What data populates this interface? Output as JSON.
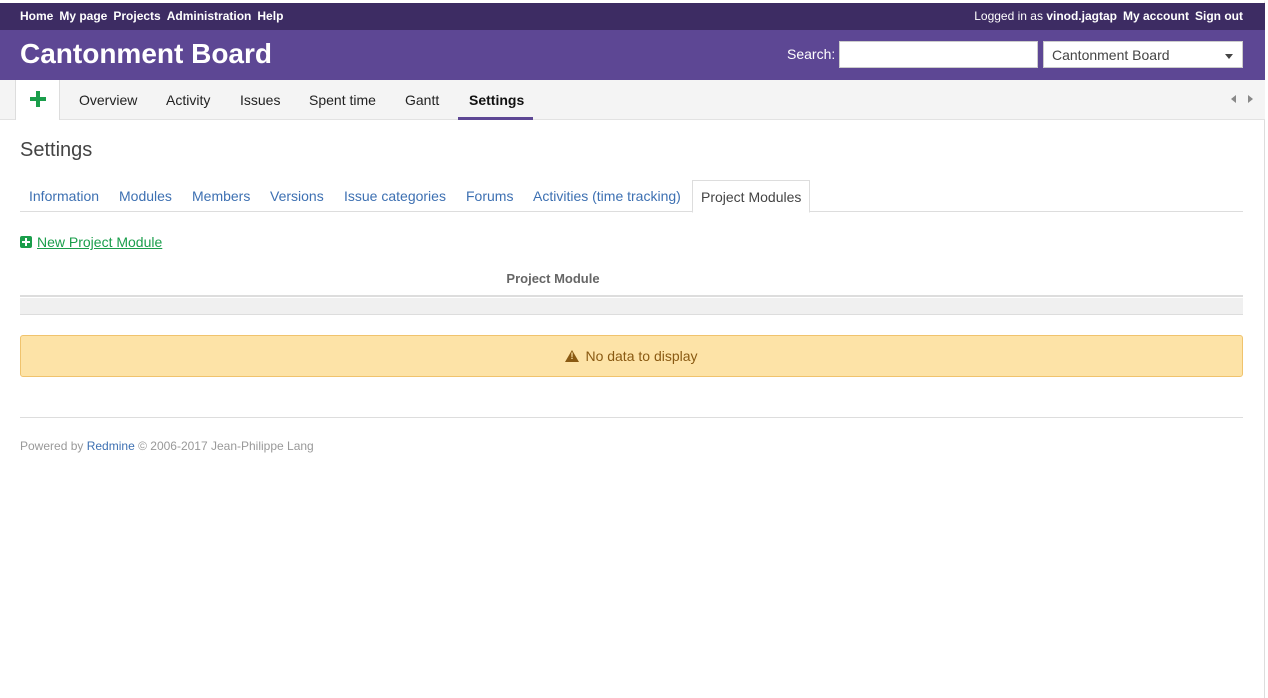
{
  "top_menu": {
    "items": [
      "Home",
      "My page",
      "Projects",
      "Administration",
      "Help"
    ],
    "logged_in_prefix": "Logged in as",
    "username": "vinod.jagtap",
    "my_account": "My account",
    "sign_out": "Sign out"
  },
  "header": {
    "title": "Cantonment Board",
    "search_label": "Search:",
    "search_value": "",
    "project_select": "Cantonment Board"
  },
  "main_menu": {
    "items": [
      "Overview",
      "Activity",
      "Issues",
      "Spent time",
      "Gantt",
      "Settings"
    ],
    "selected": "Settings"
  },
  "page": {
    "title": "Settings",
    "tabs": [
      "Information",
      "Modules",
      "Members",
      "Versions",
      "Issue categories",
      "Forums",
      "Activities (time tracking)",
      "Project Modules"
    ],
    "active_tab": "Project Modules",
    "new_link": "New Project Module",
    "table_header": "Project Module",
    "no_data": "No data to display"
  },
  "footer": {
    "prefix": "Powered by",
    "link": "Redmine",
    "suffix": "© 2006-2017 Jean-Philippe Lang"
  },
  "colors": {
    "top_bar": "#3d2c63",
    "header": "#5d4794",
    "link": "#3d70b2",
    "green": "#1a9e4b",
    "warning_bg": "#fde3a7"
  }
}
